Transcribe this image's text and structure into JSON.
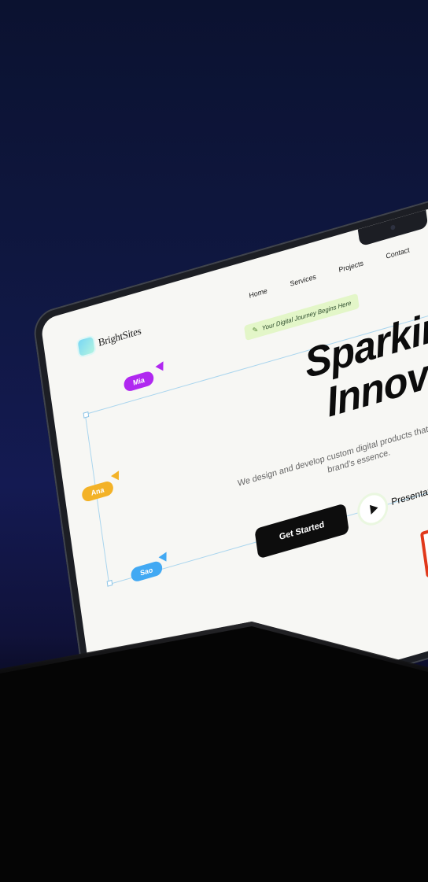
{
  "site": {
    "logo_text": "BrightSites",
    "nav": [
      "Home",
      "Services",
      "Projects",
      "Contact"
    ],
    "badge": {
      "icon": "rocket-icon",
      "text": "Your Digital Journey Begins Here"
    },
    "hero": {
      "title_line1": "Sparking Digi",
      "title_line2": "Innovations",
      "subtitle": "We design and develop custom digital products that capture your brand's essence."
    },
    "cursors": [
      {
        "name": "Mia",
        "color": "#b028f0"
      },
      {
        "name": "Ana",
        "color": "#f3b227"
      },
      {
        "name": "Sao",
        "color": "#42a9f3"
      }
    ],
    "cta_primary": "Get Started",
    "cta_secondary": "Presentation"
  }
}
